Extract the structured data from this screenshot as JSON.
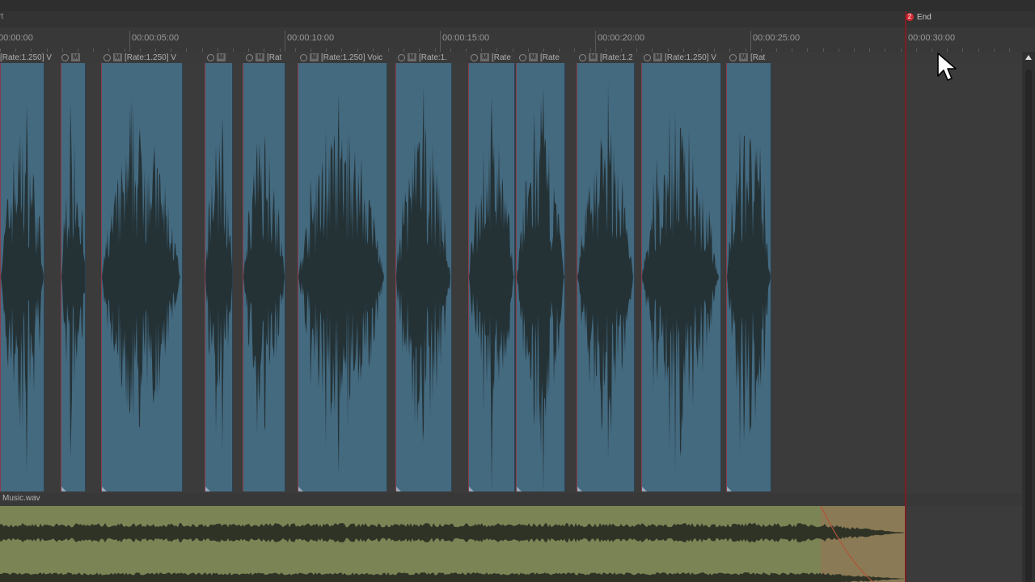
{
  "header": {
    "left_fragment": "rt"
  },
  "ruler": {
    "labels": [
      "00:00:00",
      "00:00:05:00",
      "00:00:10:00",
      "00:00:15:00",
      "00:00:20:00",
      "00:00:25:00",
      "00:00:30:00"
    ]
  },
  "marker": {
    "number": "2",
    "label": "End"
  },
  "voice_clip_headers": [
    "[Rate:1.250] V",
    "",
    "[Rate:1.250] V",
    "",
    "[Rat",
    "[Rate:1.250] Voic",
    "[Rate:1.",
    "[Rate",
    "[Rate",
    "[Rate:1.2",
    "[Rate:1.250] V",
    "[Rat"
  ],
  "mute_glyph": "M",
  "music": {
    "clip_name": "Music.wav"
  },
  "colors": {
    "voice_clip": "#446a80",
    "waveform": "#243236",
    "music_clip": "#7b8455",
    "end_marker": "#d42a35"
  },
  "icons": [
    "power-icon",
    "mute-icon",
    "mouse-pointer-icon",
    "scroll-up-icon"
  ]
}
